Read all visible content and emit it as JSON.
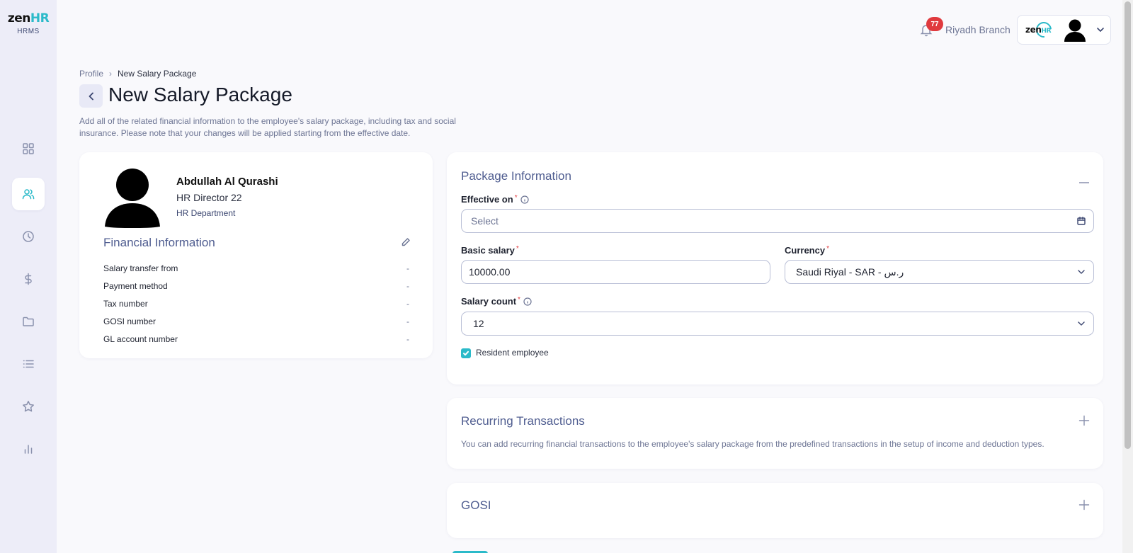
{
  "app": {
    "logo_main": "zen",
    "logo_accent": "HR",
    "logo_sub": "HRMS"
  },
  "sidebar": {
    "items": [
      {
        "name": "dashboard-icon",
        "active": false
      },
      {
        "name": "users-icon",
        "active": true
      },
      {
        "name": "clock-icon",
        "active": false
      },
      {
        "name": "dollar-icon",
        "active": false
      },
      {
        "name": "folder-icon",
        "active": false
      },
      {
        "name": "list-icon",
        "active": false
      },
      {
        "name": "star-icon",
        "active": false
      },
      {
        "name": "bar-chart-icon",
        "active": false
      }
    ]
  },
  "topbar": {
    "notification_count": "77",
    "branch": "Riyadh Branch",
    "mini_logo_main": "zen",
    "mini_logo_accent": "HR"
  },
  "breadcrumb": {
    "parent": "Profile",
    "current": "New Salary Package"
  },
  "page": {
    "title": "New Salary Package",
    "description": "Add all of the related financial information to the employee's salary package, including tax and social insurance. Please note that your changes will be applied starting from the effective date."
  },
  "employee": {
    "name": "Abdullah Al Qurashi",
    "role": "HR Director 22",
    "department": "HR Department"
  },
  "financial": {
    "title": "Financial Information",
    "rows": [
      {
        "label": "Salary transfer from",
        "value": "-"
      },
      {
        "label": "Payment method",
        "value": "-"
      },
      {
        "label": "Tax number",
        "value": "-"
      },
      {
        "label": "GOSI number",
        "value": "-"
      },
      {
        "label": "GL account number",
        "value": "-"
      }
    ]
  },
  "package": {
    "title": "Package Information",
    "effective_label": "Effective on",
    "effective_placeholder": "Select",
    "basic_salary_label": "Basic salary",
    "basic_salary_value": "10000.00",
    "currency_label": "Currency",
    "currency_value": "Saudi Riyal - SAR - ر.س",
    "salary_count_label": "Salary count",
    "salary_count_value": "12",
    "resident_label": "Resident employee",
    "resident_checked": true,
    "required_mark": "*"
  },
  "recurring": {
    "title": "Recurring Transactions",
    "description": "You can add recurring financial transactions to the employee's salary package from the predefined transactions in the setup of income and deduction types."
  },
  "gosi": {
    "title": "GOSI"
  },
  "colors": {
    "accent": "#2bbac9",
    "section_title": "#4f5d90",
    "badge": "#e03a3e",
    "sidebar_bg": "#ededf8"
  }
}
